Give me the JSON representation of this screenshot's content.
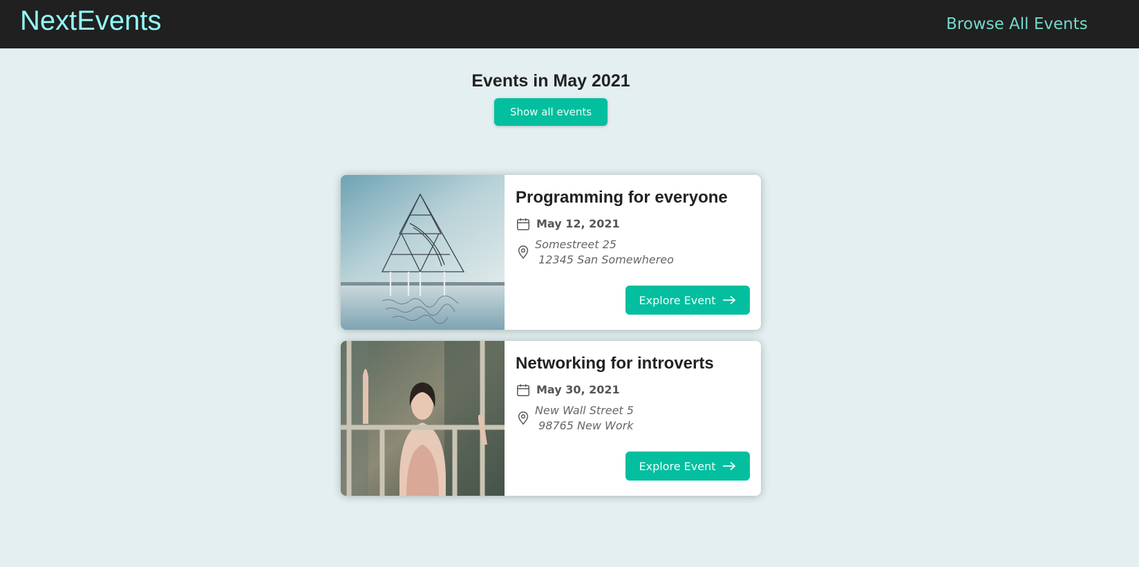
{
  "header": {
    "logo": "NextEvents",
    "nav_link": "Browse All Events"
  },
  "main": {
    "title": "Events in May 2021",
    "show_all_label": "Show all events",
    "events": [
      {
        "title": "Programming for everyone",
        "date": "May 12, 2021",
        "address_line1": "Somestreet 25",
        "address_line2": " 12345 San Somewhereo",
        "button_label": "Explore Event",
        "image": "triangle-tower-on-water-photo"
      },
      {
        "title": "Networking for introverts",
        "date": "May 30, 2021",
        "address_line1": "New Wall Street 5",
        "address_line2": " 98765 New Work",
        "button_label": "Explore Event",
        "image": "woman-at-window-photo"
      }
    ]
  },
  "colors": {
    "header_bg": "#202020",
    "logo": "#94fdfd",
    "nav_link": "#74d9c9",
    "page_bg": "#e3eff0",
    "accent": "#03be9f"
  },
  "icons": {
    "date": "calendar-icon",
    "address": "map-pin-icon",
    "button": "arrow-right-icon"
  }
}
